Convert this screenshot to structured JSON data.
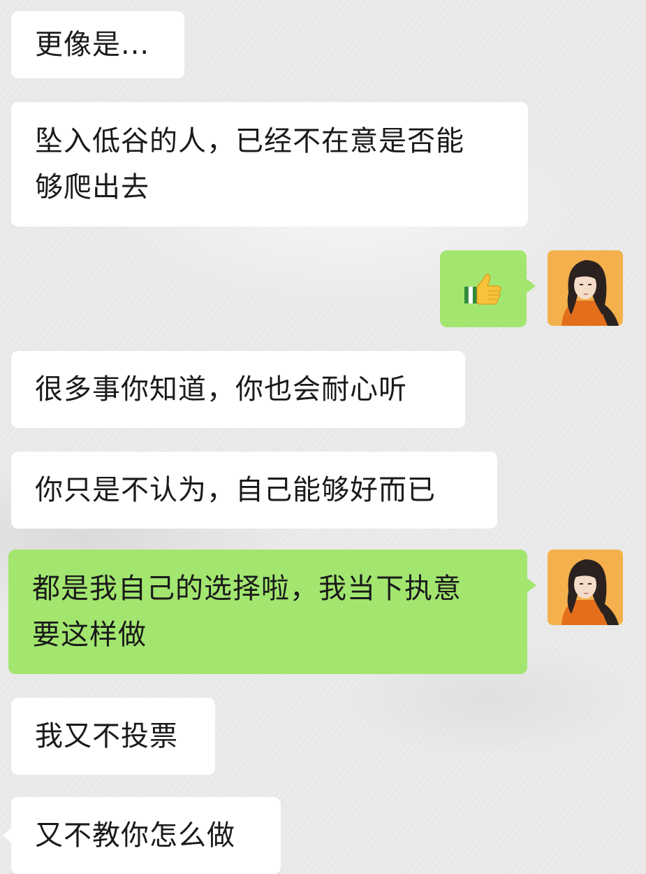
{
  "messages": [
    {
      "side": "in",
      "text": "更像是..."
    },
    {
      "side": "in",
      "text": "坠入低谷的人，已经不在意是否能\n够爬出去"
    },
    {
      "side": "out",
      "icon": "thumbs-up-emoji"
    },
    {
      "side": "in",
      "text": "很多事你知道，你也会耐心听"
    },
    {
      "side": "in",
      "text": "你只是不认为，自己能够好而已"
    },
    {
      "side": "out",
      "text": "都是我自己的选择啦，我当下执意\n要这样做"
    },
    {
      "side": "in",
      "text": "我又不投票"
    },
    {
      "side": "in",
      "text": "又不教你怎么做"
    }
  ],
  "colors": {
    "incoming_bubble": "#ffffff",
    "outgoing_bubble": "#a2e66f",
    "text": "#1a1a1a",
    "background": "#ececec"
  },
  "icons": {
    "avatar": "user-avatar-illustration",
    "emoji": "thumbs-up-emoji"
  }
}
